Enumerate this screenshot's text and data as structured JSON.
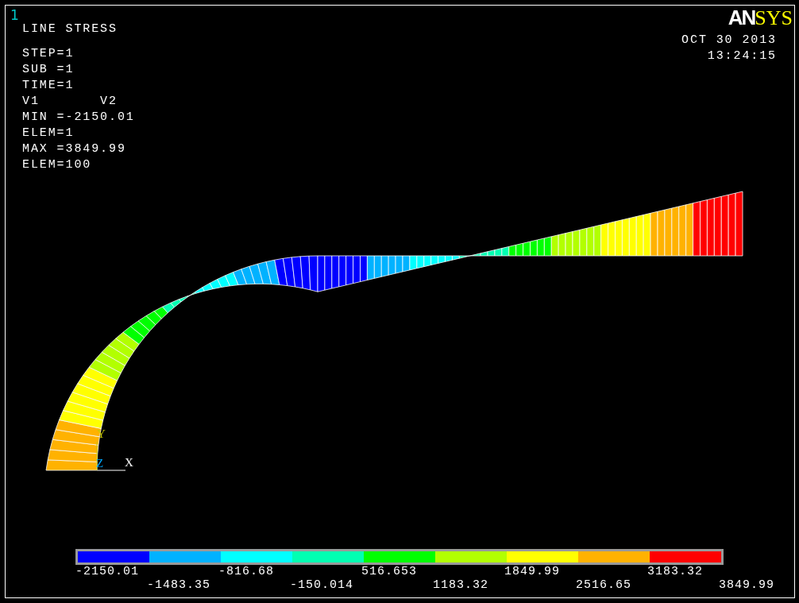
{
  "window": {
    "number": "1",
    "logo": {
      "part_1": "AN",
      "part_2": "SYS"
    }
  },
  "plot_title": "LINE STRESS",
  "info_lines": [
    "STEP=1",
    "SUB =1",
    "TIME=1",
    "V1       V2",
    "MIN =-2150.01",
    "ELEM=1",
    "MAX =3849.99",
    "ELEM=100"
  ],
  "date": "OCT 30 2013",
  "time": "13:24:15",
  "triad": {
    "y_label": "Y",
    "z_label": "Z",
    "x_label": "X"
  },
  "legend": {
    "segments": [
      {
        "color": "#0000ff"
      },
      {
        "color": "#00b2ff"
      },
      {
        "color": "#00ffff"
      },
      {
        "color": "#00ffb2"
      },
      {
        "color": "#00ff00"
      },
      {
        "color": "#b2ff00"
      },
      {
        "color": "#ffff00"
      },
      {
        "color": "#ffb200"
      },
      {
        "color": "#ff0000"
      }
    ],
    "labels": [
      "-2150.01",
      "-1483.35",
      "-816.68",
      "-150.014",
      "516.653",
      "1183.32",
      "1849.99",
      "2516.65",
      "3183.32",
      "3849.99"
    ]
  }
}
